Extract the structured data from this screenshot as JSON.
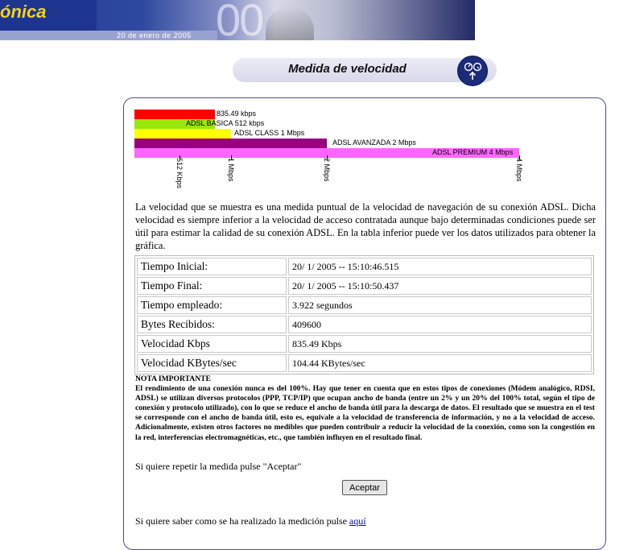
{
  "banner": {
    "logo_text": "ónica",
    "date": "20 de enero de 2005",
    "big_number": "00"
  },
  "header": {
    "title": "Medida de velocidad",
    "icon": "speed-measure-icon"
  },
  "chart_data": {
    "type": "bar",
    "orientation": "horizontal",
    "unit": "kbps",
    "xlim": [
      0,
      4096
    ],
    "ticks": [
      {
        "value": 512,
        "label": "512 Kbps"
      },
      {
        "value": 1024,
        "label": "1 Mbps"
      },
      {
        "value": 2048,
        "label": "2 Mbps"
      },
      {
        "value": 4096,
        "label": "4 Mbps"
      }
    ],
    "bars": [
      {
        "label": "835.49 kbps",
        "value": 835.49,
        "color": "#ff0000"
      },
      {
        "label": "ADSL BASICA 512 kbps",
        "value": 512,
        "color": "#99e60a"
      },
      {
        "label": "ADSL CLASS 1 Mbps",
        "value": 1024,
        "color": "#ffff00"
      },
      {
        "label": "ADSL AVANZADA 2 Mbps",
        "value": 2048,
        "color": "#990080"
      },
      {
        "label": "ADSL PREMIUM 4 Mbps",
        "value": 4096,
        "color": "#ff66ff"
      }
    ]
  },
  "description": "La velocidad que se muestra es una medida puntual de la velocidad de navegación de su conexión ADSL. Dicha velocidad es siempre inferior a la velocidad de acceso contratada aunque bajo determinadas condiciones puede ser útil para estimar la calidad de su conexión ADSL. En la tabla inferior puede ver los datos utilizados para obtener la gráfica.",
  "table": {
    "rows": [
      {
        "key": "Tiempo Inicial:",
        "value": "20/ 1/ 2005 -- 15:10:46.515"
      },
      {
        "key": "Tiempo Final:",
        "value": "20/ 1/ 2005 -- 15:10:50.437"
      },
      {
        "key": "Tiempo empleado:",
        "value": "3.922 segundos"
      },
      {
        "key": "Bytes Recibidos:",
        "value": "409600"
      },
      {
        "key": "Velocidad Kbps",
        "value": "835.49 Kbps"
      },
      {
        "key": "Velocidad KBytes/sec",
        "value": "104.44 KBytes/sec"
      }
    ]
  },
  "note": {
    "title": "NOTA IMPORTANTE",
    "body": "El rendimiento de una conexión nunca es del 100%. Hay que tener en cuenta que en estos tipos de conexiones (Módem analógico, RDSI, ADSL) se utilizan diversos protocolos (PPP, TCP/IP) que ocupan ancho de banda (entre un 2% y un 20% del 100% total, según el tipo de conexión y protocolo utilizado), con lo que se reduce el ancho de banda útil para la descarga de datos. El resultado que se muestra en el test se corresponde con el ancho de banda útil, esto es, equivale a la velocidad de transferencia de información, y no a la velocidad de acceso. Adicionalmente, existen otros factores no medibles que pueden contribuir a reducir la velocidad de la conexión, como son la congestión en la red, interferencias electromagnéticas, etc., que también influyen en el resultado final."
  },
  "repeat_text": "Si quiere repetir la medida pulse \"Aceptar\"",
  "accept_button": "Aceptar",
  "how_text": "Si quiere saber como se ha realizado la medición pulse ",
  "how_link": "aquí"
}
